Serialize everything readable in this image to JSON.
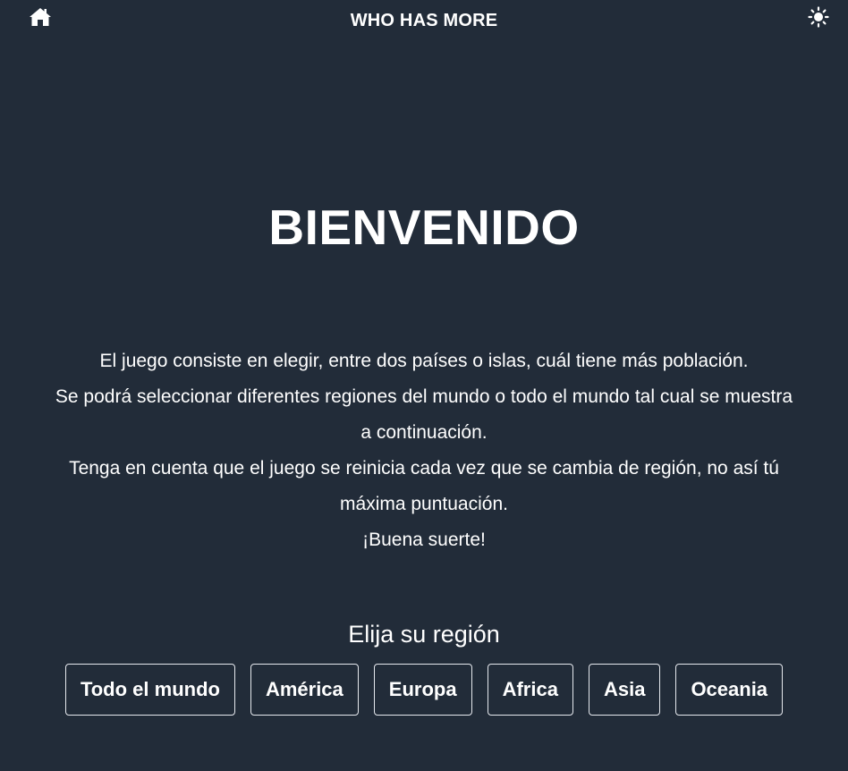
{
  "header": {
    "title": "WHO HAS MORE",
    "home_icon": "home-icon",
    "theme_icon": "sun-icon"
  },
  "main": {
    "heading": "BIENVENIDO",
    "intro_lines": [
      "El juego consiste en elegir, entre dos países o islas, cuál tiene más población.",
      "Se podrá seleccionar diferentes regiones del mundo o todo el mundo tal cual se muestra a continuación.",
      "Tenga en cuenta que el juego se reinicia cada vez que se cambia de región, no así tú máxima puntuación.",
      "¡Buena suerte!"
    ],
    "region_prompt": "Elija su región",
    "regions": [
      {
        "label": "Todo el mundo"
      },
      {
        "label": "América"
      },
      {
        "label": "Europa"
      },
      {
        "label": "Africa"
      },
      {
        "label": "Asia"
      },
      {
        "label": "Oceania"
      }
    ]
  },
  "colors": {
    "background": "#222c39",
    "text": "#ffffff",
    "button_border": "#e6e9ee"
  }
}
